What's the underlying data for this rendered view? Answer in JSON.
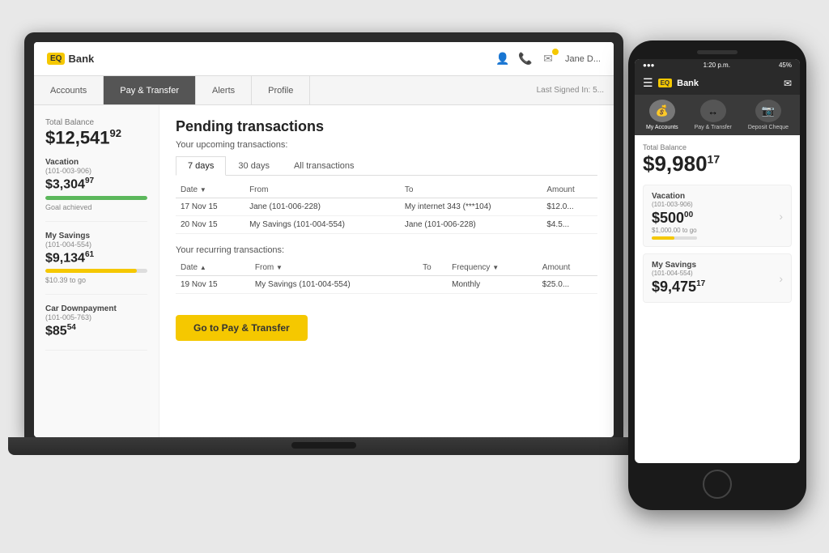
{
  "laptop": {
    "header": {
      "logo_badge": "EQ",
      "logo_text": "Bank",
      "user_name": "Jane D...",
      "last_signed": "Last Signed In: 5..."
    },
    "nav": {
      "items": [
        {
          "label": "Accounts",
          "active": false
        },
        {
          "label": "Pay & Transfer",
          "active": true
        },
        {
          "label": "Alerts",
          "active": false
        },
        {
          "label": "Profile",
          "active": false
        }
      ]
    },
    "sidebar": {
      "total_label": "Total Balance",
      "total_amount": "$12,541",
      "total_cents": "92",
      "accounts": [
        {
          "name": "Vacation",
          "number": "(101-003-906)",
          "amount": "$3,304",
          "cents": "97",
          "progress": 100,
          "progress_color": "green",
          "status": "Goal achieved"
        },
        {
          "name": "My Savings",
          "number": "(101-004-554)",
          "amount": "$9,134",
          "cents": "61",
          "progress": 90,
          "progress_color": "yellow",
          "status": "$10.39 to go"
        },
        {
          "name": "Car Downpayment",
          "number": "(101-005-763)",
          "amount": "$85",
          "cents": "54",
          "progress": 0,
          "progress_color": "yellow",
          "status": ""
        }
      ]
    },
    "main": {
      "title": "Pending transactions",
      "upcoming_label": "Your upcoming transactions:",
      "tabs": [
        {
          "label": "7 days",
          "active": true
        },
        {
          "label": "30 days",
          "active": false
        },
        {
          "label": "All transactions",
          "active": false
        }
      ],
      "upcoming_columns": [
        "Date",
        "From",
        "To",
        "Amount"
      ],
      "upcoming_rows": [
        {
          "date": "17 Nov 15",
          "from": "Jane (101-006-228)",
          "to": "My internet 343 (***104)",
          "amount": "$12.0..."
        },
        {
          "date": "20 Nov 15",
          "from": "My Savings (101-004-554)",
          "to": "Jane  (101-006-228)",
          "amount": "$4.5..."
        }
      ],
      "recurring_label": "Your recurring transactions:",
      "recurring_columns": [
        "Date",
        "From",
        "To",
        "Frequency",
        "Amount"
      ],
      "recurring_rows": [
        {
          "date": "19 Nov 15",
          "from": "My Savings (101-004-554)",
          "to": "",
          "frequency": "Monthly",
          "amount": "$25.0..."
        }
      ],
      "go_btn_label": "Go to Pay & Transfer"
    }
  },
  "phone": {
    "status_bar": {
      "time": "1:20 p.m.",
      "battery": "45%"
    },
    "header": {
      "logo_badge": "EQ",
      "logo_text": "Bank"
    },
    "nav": {
      "items": [
        {
          "label": "My Accounts",
          "icon": "💰",
          "active": true
        },
        {
          "label": "Pay & Transfer",
          "icon": "↔",
          "active": false
        },
        {
          "label": "Deposit Cheque",
          "icon": "📷",
          "active": false
        }
      ]
    },
    "total_label": "Total Balance",
    "total_amount": "$9,980",
    "total_cents": "17",
    "accounts": [
      {
        "name": "Vacation",
        "number": "(101-003-906)",
        "amount": "$500",
        "cents": "00",
        "sub": "$1,000.00 to go",
        "progress": 50,
        "show_progress": true
      },
      {
        "name": "My Savings",
        "number": "(101-004-554)",
        "amount": "$9,475",
        "cents": "17",
        "sub": "",
        "progress": 0,
        "show_progress": false
      }
    ]
  }
}
